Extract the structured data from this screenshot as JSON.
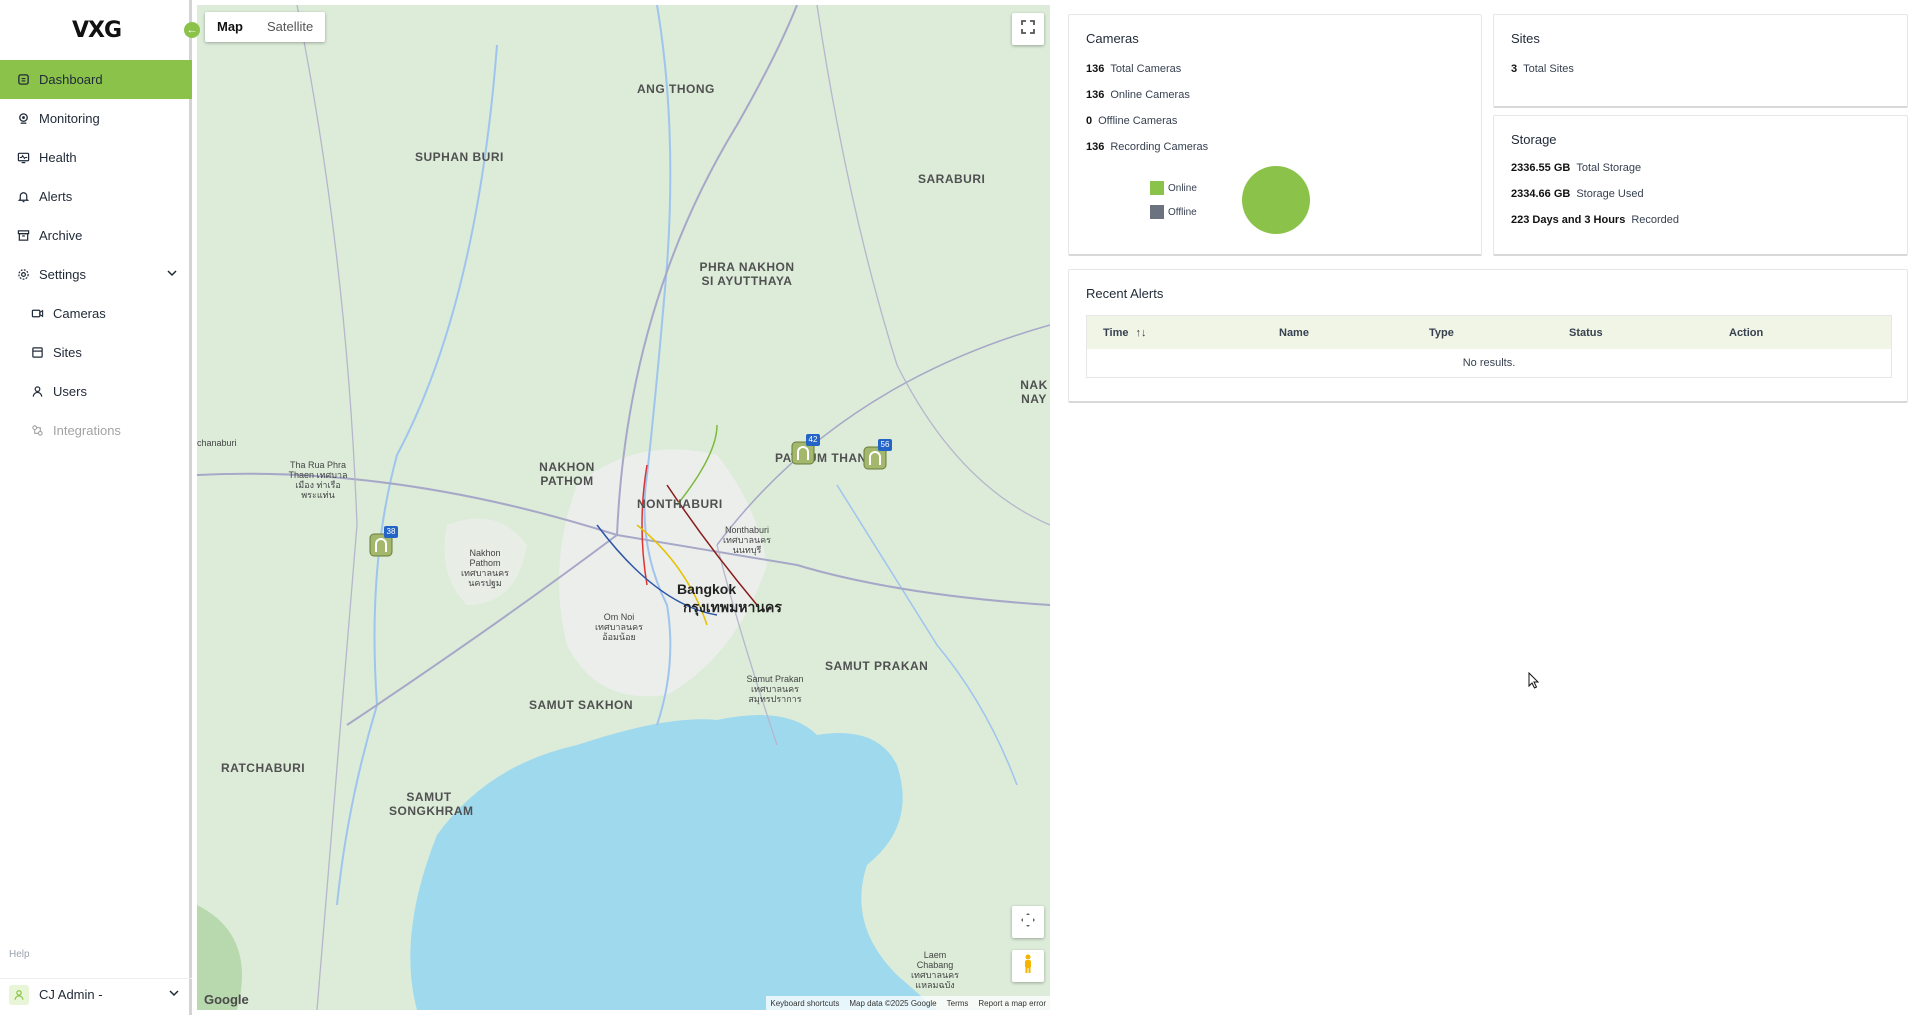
{
  "brand": {
    "logo": "VXG"
  },
  "sidebar": {
    "items": [
      {
        "label": "Dashboard",
        "icon": "dashboard-icon",
        "active": true
      },
      {
        "label": "Monitoring",
        "icon": "monitoring-icon"
      },
      {
        "label": "Health",
        "icon": "health-icon"
      },
      {
        "label": "Alerts",
        "icon": "bell-icon"
      },
      {
        "label": "Archive",
        "icon": "archive-icon"
      },
      {
        "label": "Settings",
        "icon": "gear-icon",
        "expanded": true
      }
    ],
    "sub_items": [
      {
        "label": "Cameras",
        "icon": "camera-icon"
      },
      {
        "label": "Sites",
        "icon": "sites-icon"
      },
      {
        "label": "Users",
        "icon": "user-icon"
      },
      {
        "label": "Integrations",
        "icon": "integrations-icon",
        "disabled": true
      }
    ],
    "help_label": "Help",
    "user_name": "CJ Admin -"
  },
  "map": {
    "tabs": [
      "Map",
      "Satellite"
    ],
    "selected_tab": "Map",
    "markers": [
      {
        "count": "42"
      },
      {
        "count": "56"
      },
      {
        "count": "38"
      }
    ],
    "regions": [
      "ANG THONG",
      "SUPHAN BURI",
      "SARABURI",
      "PHRA NAKHON SI AYUTTHAYA",
      "NAKHON PATHOM",
      "NONTHABURI",
      "PATHUM THANI",
      "SAMUT SAKHON",
      "SAMUT PRAKAN",
      "RATCHABURI",
      "SAMUT SONGKHRAM",
      "NAK NAY"
    ],
    "cities": [
      "Bangkok",
      "กรุงเทพมหานคร"
    ],
    "towns": [
      "Nonthaburi เทศบาลนคร นนทบุรี",
      "Nakhon Pathom เทศบาลนคร นครปฐม",
      "Om Noi เทศบาลนคร อ้อมน้อย",
      "Samut Prakan เทศบาลนคร สมุทรปราการ",
      "Laem Chabang เทศบาลนคร แหลมฉบัง",
      "Tha Rua Phra Thaen เทศบาลเมือง ท่าเรือ พระแท่น",
      "chanaburi"
    ],
    "google_label": "Google",
    "attribution": [
      "Keyboard shortcuts",
      "Map data ©2025 Google",
      "Terms",
      "Report a map error"
    ]
  },
  "cameras": {
    "title": "Cameras",
    "rows": [
      {
        "value": "136",
        "label": "Total Cameras"
      },
      {
        "value": "136",
        "label": "Online Cameras"
      },
      {
        "value": "0",
        "label": "Offline Cameras"
      },
      {
        "value": "136",
        "label": "Recording Cameras"
      }
    ],
    "legend": [
      {
        "label": "Online",
        "color": "#8bc34a"
      },
      {
        "label": "Offline",
        "color": "#6b7280"
      }
    ]
  },
  "chart_data": {
    "type": "pie",
    "categories": [
      "Online",
      "Offline"
    ],
    "values": [
      136,
      0
    ],
    "colors": [
      "#8bc34a",
      "#6b7280"
    ],
    "legend": "left"
  },
  "sites": {
    "title": "Sites",
    "rows": [
      {
        "value": "3",
        "label": "Total Sites"
      }
    ]
  },
  "storage": {
    "title": "Storage",
    "rows": [
      {
        "value": "2336.55 GB",
        "label": "Total Storage"
      },
      {
        "value": "2334.66 GB",
        "label": "Storage Used"
      },
      {
        "value": "223 Days and 3 Hours",
        "label": "Recorded"
      }
    ]
  },
  "alerts": {
    "title": "Recent Alerts",
    "columns": [
      "Time",
      "Name",
      "Type",
      "Status",
      "Action"
    ],
    "sort_indicator": "↑↓",
    "empty_text": "No results."
  }
}
